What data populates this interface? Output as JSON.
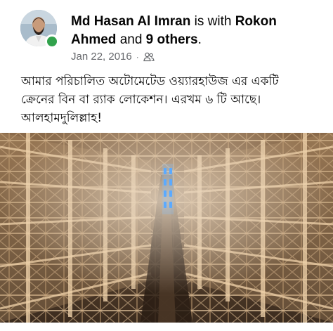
{
  "post": {
    "author": "Md Hasan Al Imran",
    "connector": "is with",
    "tagged": "Rokon Ahmed",
    "and_word": "and",
    "others": "9 others",
    "period": ".",
    "date": "Jan 22, 2016",
    "separator": "·",
    "audience_icon": "friends-icon",
    "text_line1": "আমার পরিচালিত অটোমেটেড ওয়্যারহাউজ এর একটি",
    "text_line2": "ক্রেনের বিন বা র‍্যাক লোকেশন। এরখম ৬ টি আছে।",
    "text_line3": "আলহামদুলিল্লাহ!"
  },
  "colors": {
    "online": "#31a24c",
    "meta_text": "#65676b",
    "text": "#050505"
  },
  "photo": {
    "subject": "automated warehouse rack aisle"
  }
}
